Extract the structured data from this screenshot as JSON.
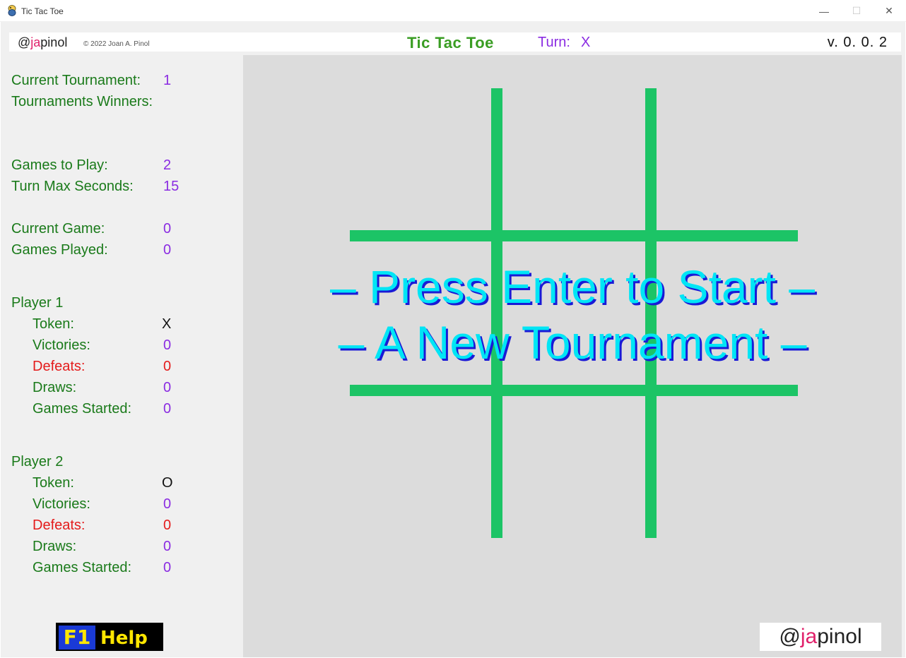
{
  "window": {
    "title": "Tic Tac Toe",
    "buttons": {
      "minimize": "—",
      "maximize": "☐",
      "close": "✕"
    }
  },
  "header": {
    "brand_prefix": "@",
    "brand_highlight": "ja",
    "brand_suffix": "pinol",
    "copyright": "© 2022 Joan A. Pinol",
    "game_title": "Tic Tac Toe",
    "turn_label": "Turn:",
    "turn_value": "X",
    "version": "v. 0. 0. 2"
  },
  "tournament": {
    "current_label": "Current Tournament:",
    "current_value": "1",
    "winners_label": "Tournaments Winners:"
  },
  "settings": {
    "games_to_play_label": "Games to Play:",
    "games_to_play_value": "2",
    "turn_max_seconds_label": "Turn Max Seconds:",
    "turn_max_seconds_value": "15"
  },
  "games": {
    "current_game_label": "Current Game:",
    "current_game_value": "0",
    "games_played_label": "Games Played:",
    "games_played_value": "0"
  },
  "player1": {
    "title": "Player 1",
    "token_label": "Token:",
    "token_value": "X",
    "victories_label": "Victories:",
    "victories_value": "0",
    "defeats_label": "Defeats:",
    "defeats_value": "0",
    "draws_label": "Draws:",
    "draws_value": "0",
    "games_started_label": "Games Started:",
    "games_started_value": "0"
  },
  "player2": {
    "title": "Player 2",
    "token_label": "Token:",
    "token_value": "O",
    "victories_label": "Victories:",
    "victories_value": "0",
    "defeats_label": "Defeats:",
    "defeats_value": "0",
    "draws_label": "Draws:",
    "draws_value": "0",
    "games_started_label": "Games Started:",
    "games_started_value": "0"
  },
  "overlay": {
    "line1": "– Press Enter to Start –",
    "line2": "– A New Tournament –"
  },
  "help": {
    "key": "F1",
    "label": "Help"
  },
  "footer_brand": {
    "prefix": "@",
    "highlight": "ja",
    "suffix": "pinol"
  },
  "colors": {
    "grid": "#1cc466",
    "label_green": "#1a7a1a",
    "value_purple": "#8a2be2",
    "defeat_red": "#e41b1b",
    "overlay_cyan": "#00e5f5",
    "overlay_shadow": "#1a1ad6",
    "board_bg": "#dcdcdc",
    "sidebar_bg": "#f0f0f0"
  },
  "icons": {
    "app": "snake-icon"
  }
}
